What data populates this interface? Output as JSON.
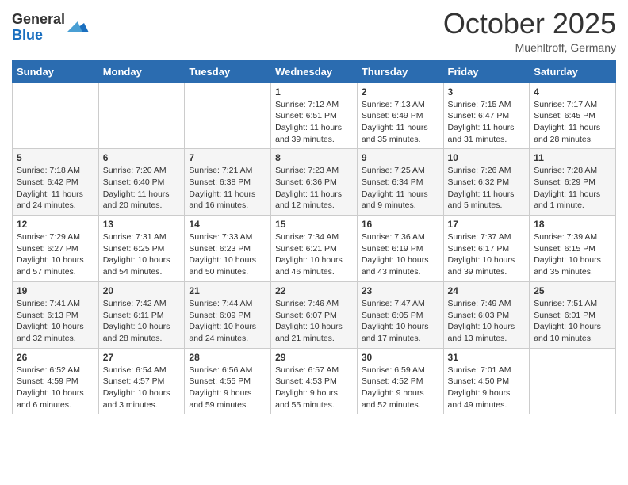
{
  "header": {
    "logo_general": "General",
    "logo_blue": "Blue",
    "month_title": "October 2025",
    "location": "Muehltroff, Germany"
  },
  "weekdays": [
    "Sunday",
    "Monday",
    "Tuesday",
    "Wednesday",
    "Thursday",
    "Friday",
    "Saturday"
  ],
  "weeks": [
    [
      {
        "day": "",
        "info": ""
      },
      {
        "day": "",
        "info": ""
      },
      {
        "day": "",
        "info": ""
      },
      {
        "day": "1",
        "info": "Sunrise: 7:12 AM\nSunset: 6:51 PM\nDaylight: 11 hours and 39 minutes."
      },
      {
        "day": "2",
        "info": "Sunrise: 7:13 AM\nSunset: 6:49 PM\nDaylight: 11 hours and 35 minutes."
      },
      {
        "day": "3",
        "info": "Sunrise: 7:15 AM\nSunset: 6:47 PM\nDaylight: 11 hours and 31 minutes."
      },
      {
        "day": "4",
        "info": "Sunrise: 7:17 AM\nSunset: 6:45 PM\nDaylight: 11 hours and 28 minutes."
      }
    ],
    [
      {
        "day": "5",
        "info": "Sunrise: 7:18 AM\nSunset: 6:42 PM\nDaylight: 11 hours and 24 minutes."
      },
      {
        "day": "6",
        "info": "Sunrise: 7:20 AM\nSunset: 6:40 PM\nDaylight: 11 hours and 20 minutes."
      },
      {
        "day": "7",
        "info": "Sunrise: 7:21 AM\nSunset: 6:38 PM\nDaylight: 11 hours and 16 minutes."
      },
      {
        "day": "8",
        "info": "Sunrise: 7:23 AM\nSunset: 6:36 PM\nDaylight: 11 hours and 12 minutes."
      },
      {
        "day": "9",
        "info": "Sunrise: 7:25 AM\nSunset: 6:34 PM\nDaylight: 11 hours and 9 minutes."
      },
      {
        "day": "10",
        "info": "Sunrise: 7:26 AM\nSunset: 6:32 PM\nDaylight: 11 hours and 5 minutes."
      },
      {
        "day": "11",
        "info": "Sunrise: 7:28 AM\nSunset: 6:29 PM\nDaylight: 11 hours and 1 minute."
      }
    ],
    [
      {
        "day": "12",
        "info": "Sunrise: 7:29 AM\nSunset: 6:27 PM\nDaylight: 10 hours and 57 minutes."
      },
      {
        "day": "13",
        "info": "Sunrise: 7:31 AM\nSunset: 6:25 PM\nDaylight: 10 hours and 54 minutes."
      },
      {
        "day": "14",
        "info": "Sunrise: 7:33 AM\nSunset: 6:23 PM\nDaylight: 10 hours and 50 minutes."
      },
      {
        "day": "15",
        "info": "Sunrise: 7:34 AM\nSunset: 6:21 PM\nDaylight: 10 hours and 46 minutes."
      },
      {
        "day": "16",
        "info": "Sunrise: 7:36 AM\nSunset: 6:19 PM\nDaylight: 10 hours and 43 minutes."
      },
      {
        "day": "17",
        "info": "Sunrise: 7:37 AM\nSunset: 6:17 PM\nDaylight: 10 hours and 39 minutes."
      },
      {
        "day": "18",
        "info": "Sunrise: 7:39 AM\nSunset: 6:15 PM\nDaylight: 10 hours and 35 minutes."
      }
    ],
    [
      {
        "day": "19",
        "info": "Sunrise: 7:41 AM\nSunset: 6:13 PM\nDaylight: 10 hours and 32 minutes."
      },
      {
        "day": "20",
        "info": "Sunrise: 7:42 AM\nSunset: 6:11 PM\nDaylight: 10 hours and 28 minutes."
      },
      {
        "day": "21",
        "info": "Sunrise: 7:44 AM\nSunset: 6:09 PM\nDaylight: 10 hours and 24 minutes."
      },
      {
        "day": "22",
        "info": "Sunrise: 7:46 AM\nSunset: 6:07 PM\nDaylight: 10 hours and 21 minutes."
      },
      {
        "day": "23",
        "info": "Sunrise: 7:47 AM\nSunset: 6:05 PM\nDaylight: 10 hours and 17 minutes."
      },
      {
        "day": "24",
        "info": "Sunrise: 7:49 AM\nSunset: 6:03 PM\nDaylight: 10 hours and 13 minutes."
      },
      {
        "day": "25",
        "info": "Sunrise: 7:51 AM\nSunset: 6:01 PM\nDaylight: 10 hours and 10 minutes."
      }
    ],
    [
      {
        "day": "26",
        "info": "Sunrise: 6:52 AM\nSunset: 4:59 PM\nDaylight: 10 hours and 6 minutes."
      },
      {
        "day": "27",
        "info": "Sunrise: 6:54 AM\nSunset: 4:57 PM\nDaylight: 10 hours and 3 minutes."
      },
      {
        "day": "28",
        "info": "Sunrise: 6:56 AM\nSunset: 4:55 PM\nDaylight: 9 hours and 59 minutes."
      },
      {
        "day": "29",
        "info": "Sunrise: 6:57 AM\nSunset: 4:53 PM\nDaylight: 9 hours and 55 minutes."
      },
      {
        "day": "30",
        "info": "Sunrise: 6:59 AM\nSunset: 4:52 PM\nDaylight: 9 hours and 52 minutes."
      },
      {
        "day": "31",
        "info": "Sunrise: 7:01 AM\nSunset: 4:50 PM\nDaylight: 9 hours and 49 minutes."
      },
      {
        "day": "",
        "info": ""
      }
    ]
  ]
}
